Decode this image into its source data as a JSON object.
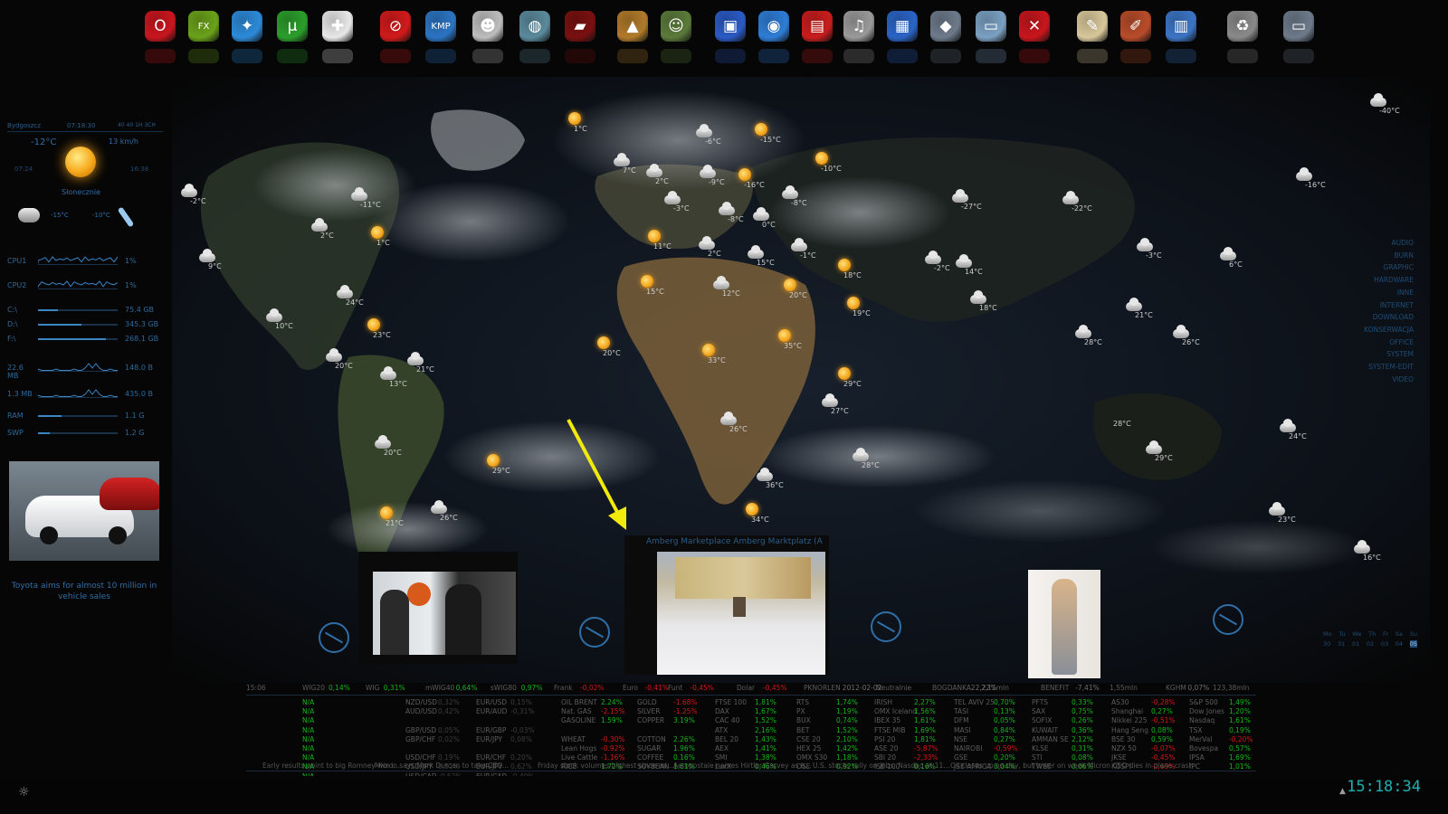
{
  "dock": {
    "icons": [
      {
        "name": "opera-icon",
        "glyph": "O",
        "color": "#c8161d"
      },
      {
        "name": "fx-icon",
        "glyph": "FX",
        "color": "#6aa11a"
      },
      {
        "name": "messenger-icon",
        "glyph": "✦",
        "color": "#2c8ad8"
      },
      {
        "name": "utorrent-icon",
        "glyph": "μ",
        "color": "#2b9e2b"
      },
      {
        "name": "gamepad-icon",
        "glyph": "✚",
        "color": "#e8e8e8"
      },
      {
        "name": "no-entry-icon",
        "glyph": "⊘",
        "color": "#d11a1a"
      },
      {
        "name": "kmp-player-icon",
        "glyph": "KMP",
        "color": "#2b74c2"
      },
      {
        "name": "alien-icon",
        "glyph": "☻",
        "color": "#bdbdbd"
      },
      {
        "name": "globe-icon",
        "glyph": "◍",
        "color": "#5a8a9c"
      },
      {
        "name": "race-car-icon",
        "glyph": "▰",
        "color": "#7a1010"
      },
      {
        "name": "tank-icon",
        "glyph": "▲",
        "color": "#b07a2a"
      },
      {
        "name": "soldier-icon",
        "glyph": "☺",
        "color": "#5b7a3a"
      },
      {
        "name": "monitor-icon",
        "glyph": "▣",
        "color": "#2a5ac4"
      },
      {
        "name": "disc-icon",
        "glyph": "◉",
        "color": "#2e7dd6"
      },
      {
        "name": "toolbox-icon",
        "glyph": "▤",
        "color": "#c81d1d"
      },
      {
        "name": "headphones-icon",
        "glyph": "♫",
        "color": "#9a9a9a"
      },
      {
        "name": "clapperboard-icon",
        "glyph": "▦",
        "color": "#2a64c6"
      },
      {
        "name": "scanner-icon",
        "glyph": "◆",
        "color": "#6d7a8a"
      },
      {
        "name": "folder-icon",
        "glyph": "▭",
        "color": "#7aa0c2"
      },
      {
        "name": "close-app-icon",
        "glyph": "✕",
        "color": "#c8161d"
      },
      {
        "name": "notepad-icon",
        "glyph": "✎",
        "color": "#d8c79a"
      },
      {
        "name": "paint-icon",
        "glyph": "✐",
        "color": "#b84c2a"
      },
      {
        "name": "calculator-icon",
        "glyph": "▥",
        "color": "#3c74c4"
      },
      {
        "name": "recycle-bin-icon",
        "glyph": "♻",
        "color": "#8a8a8a"
      },
      {
        "name": "screen-icon",
        "glyph": "▭",
        "color": "#6d7a8a"
      }
    ]
  },
  "weather": {
    "city": "Bydgoszcz",
    "time": "07:18:30",
    "extra": "40 40 1H 3CH",
    "temp": "-12°C",
    "wind": "13 km/h",
    "sunrise": "07:24",
    "sunset": "16:38",
    "condition": "Słonecznie",
    "forecast_low": "-15°C",
    "forecast_high": "-10°C"
  },
  "meters": [
    {
      "label": "CPU1",
      "value": "1%",
      "type": "graph"
    },
    {
      "label": "CPU2",
      "value": "1%",
      "type": "graph"
    },
    {
      "label": "C:\\",
      "value": "75.4 GB",
      "type": "bar",
      "fill": 0.25
    },
    {
      "label": "D:\\",
      "value": "345.3 GB",
      "type": "bar",
      "fill": 0.55
    },
    {
      "label": "F:\\",
      "value": "268.1 GB",
      "type": "bar",
      "fill": 0.85
    },
    {
      "label": "22.6 MB",
      "value": "148.0 B",
      "type": "graph"
    },
    {
      "label": "1.3 MB",
      "value": "435.0 B",
      "type": "graph"
    },
    {
      "label": "RAM",
      "value": "1.1 G",
      "type": "bar",
      "fill": 0.3
    },
    {
      "label": "SWP",
      "value": "1.2 G",
      "type": "bar",
      "fill": 0.15
    }
  ],
  "news_widget": {
    "headline": "Toyota aims for almost 10 million in vehicle sales"
  },
  "right_menu": [
    "AUDIO",
    "BURN",
    "GRAPHIC",
    "HARDWARE",
    "INNE",
    "INTERNET",
    "DOWNLOAD",
    "KONSERWACJA",
    "OFFICE",
    "SYSTEM",
    "SYSTEM-EDIT",
    "VIDEO"
  ],
  "map_markers": [
    {
      "t": "1°C",
      "k": "sun"
    },
    {
      "t": "-6°C",
      "k": "cloud"
    },
    {
      "t": "-15°C",
      "k": "sun"
    },
    {
      "t": "-10°C",
      "k": "sun"
    },
    {
      "t": "7°C",
      "k": "cloud"
    },
    {
      "t": "2°C",
      "k": "cloud"
    },
    {
      "t": "-9°C",
      "k": "cloud"
    },
    {
      "t": "-16°C",
      "k": "sun"
    },
    {
      "t": "-8°C",
      "k": "cloud"
    },
    {
      "t": "-11°C",
      "k": "cloud"
    },
    {
      "t": "-3°C",
      "k": "cloud"
    },
    {
      "t": "-8°C",
      "k": "cloud"
    },
    {
      "t": "0°C",
      "k": "cloud"
    },
    {
      "t": "-2°C",
      "k": "cloud"
    },
    {
      "t": "2°C",
      "k": "cloud"
    },
    {
      "t": "1°C",
      "k": "sun"
    },
    {
      "t": "11°C",
      "k": "sun"
    },
    {
      "t": "2°C",
      "k": "cloud"
    },
    {
      "t": "15°C",
      "k": "cloud"
    },
    {
      "t": "-1°C",
      "k": "cloud"
    },
    {
      "t": "9°C",
      "k": "cloud"
    },
    {
      "t": "18°C",
      "k": "sun"
    },
    {
      "t": "15°C",
      "k": "sun"
    },
    {
      "t": "12°C",
      "k": "cloud"
    },
    {
      "t": "20°C",
      "k": "sun"
    },
    {
      "t": "19°C",
      "k": "sun"
    },
    {
      "t": "24°C",
      "k": "cloud"
    },
    {
      "t": "10°C",
      "k": "cloud"
    },
    {
      "t": "23°C",
      "k": "sun"
    },
    {
      "t": "20°C",
      "k": "sun"
    },
    {
      "t": "33°C",
      "k": "sun"
    },
    {
      "t": "35°C",
      "k": "sun"
    },
    {
      "t": "20°C",
      "k": "cloud"
    },
    {
      "t": "21°C",
      "k": "cloud"
    },
    {
      "t": "13°C",
      "k": "cloud"
    },
    {
      "t": "29°C",
      "k": "sun"
    },
    {
      "t": "27°C",
      "k": "cloud"
    },
    {
      "t": "26°C",
      "k": "cloud"
    },
    {
      "t": "20°C",
      "k": "cloud"
    },
    {
      "t": "29°C",
      "k": "sun"
    },
    {
      "t": "28°C",
      "k": "cloud"
    },
    {
      "t": "36°C",
      "k": "cloud"
    },
    {
      "t": "34°C",
      "k": "sun"
    },
    {
      "t": "21°C",
      "k": "sun"
    },
    {
      "t": "26°C",
      "k": "cloud"
    },
    {
      "t": "-40°C",
      "k": "cloud"
    },
    {
      "t": "-16°C",
      "k": "cloud"
    },
    {
      "t": "-27°C",
      "k": "cloud"
    },
    {
      "t": "-22°C",
      "k": "cloud"
    },
    {
      "t": "-3°C",
      "k": "cloud"
    },
    {
      "t": "6°C",
      "k": "cloud"
    },
    {
      "t": "-2°C",
      "k": "cloud"
    },
    {
      "t": "14°C",
      "k": "cloud"
    },
    {
      "t": "18°C",
      "k": "cloud"
    },
    {
      "t": "21°C",
      "k": "cloud"
    },
    {
      "t": "28°C",
      "k": "cloud"
    },
    {
      "t": "26°C",
      "k": "cloud"
    },
    {
      "t": "28°C",
      "k": "none"
    },
    {
      "t": "24°C",
      "k": "cloud"
    },
    {
      "t": "29°C",
      "k": "cloud"
    },
    {
      "t": "23°C",
      "k": "cloud"
    },
    {
      "t": "16°C",
      "k": "cloud"
    }
  ],
  "webcam": {
    "title": "Amberg Marketplace  Amberg Marktplatz (A"
  },
  "calendar": {
    "days": [
      "Mo",
      "Tu",
      "We",
      "Th",
      "Fr",
      "Sa",
      "Su"
    ],
    "dates": [
      "30",
      "31",
      "01",
      "02",
      "03",
      "04",
      "05"
    ]
  },
  "ticker": {
    "header": [
      {
        "n": "15:06",
        "v": "",
        "c": ""
      },
      {
        "n": "WIG20",
        "v": "0,14%",
        "c": "pos"
      },
      {
        "n": "WIG",
        "v": "0,31%",
        "c": "pos"
      },
      {
        "n": "mWIG40",
        "v": "0,64%",
        "c": "pos"
      },
      {
        "n": "sWIG80",
        "v": "0,97%",
        "c": "pos"
      },
      {
        "n": "Frank",
        "v": "-0,02%",
        "c": "neg"
      },
      {
        "n": "Euro",
        "v": "-0,41%",
        "c": "neg"
      },
      {
        "n": "Funt",
        "v": "-0,45%",
        "c": "neg"
      },
      {
        "n": "Dolar",
        "v": "-0,45%",
        "c": "neg"
      },
      {
        "n": "PKNORLEN",
        "v": "2012-02-02",
        "c": ""
      },
      {
        "n": "Neutralnie",
        "v": "",
        "c": ""
      },
      {
        "n": "BOGDANKA",
        "v": "22,22%",
        "c": ""
      },
      {
        "n": "2,11mln",
        "v": "",
        "c": ""
      },
      {
        "n": "BENEFIT",
        "v": "-7,41%",
        "c": ""
      },
      {
        "n": "1,55mln",
        "v": "",
        "c": ""
      },
      {
        "n": "KGHM",
        "v": "0,07%",
        "c": ""
      },
      {
        "n": "123,38mln",
        "v": "",
        "c": ""
      }
    ],
    "na_col": [
      "N/A",
      "N/A",
      "N/A",
      "N/A",
      "N/A",
      "N/A",
      "N/A",
      "N/A",
      "N/A"
    ],
    "fx_col": [
      [
        "NZD/USD",
        "0,32%",
        "EUR/USD",
        "0,15%"
      ],
      [
        "AUD/USD",
        "0,42%",
        "EUR/AUD",
        "-0,31%"
      ],
      [
        "",
        "",
        "",
        ""
      ],
      [
        "GBP/USD",
        "0,05%",
        "EUR/GBP",
        "-0,03%"
      ],
      [
        "GBP/CHF",
        "0,02%",
        "EUR/JPY",
        "0,08%"
      ],
      [
        "",
        "",
        "",
        ""
      ],
      [
        "USD/CHF",
        "0,19%",
        "EUR/CHF",
        "0,20%"
      ],
      [
        "USD/JPY",
        "0,51%",
        "EUR/JPY",
        "0,62%"
      ],
      [
        "USD/CAD",
        "-0,52%",
        "EUR/CAD",
        "-0,40%"
      ]
    ],
    "commod_col": [
      [
        "OIL BRENT",
        "2.24%",
        "GOLD",
        "-1.68%"
      ],
      [
        "Nat. GAS",
        "-2.15%",
        "SILVER",
        "-1.25%"
      ],
      [
        "GASOLINE",
        "1.59%",
        "COPPER",
        "3.19%"
      ],
      [
        "",
        "",
        "",
        ""
      ],
      [
        "WHEAT",
        "-0.30%",
        "COTTON",
        "2.26%"
      ],
      [
        "Lean Hogs",
        "-0.92%",
        "SUGAR",
        "1.96%"
      ],
      [
        "Live Cattle",
        "-1.16%",
        "COFFEE",
        "0.16%"
      ],
      [
        "RICE",
        "1.72%",
        "SOYBEAN",
        "1.61%"
      ]
    ],
    "index_col": [
      [
        "FTSE 100",
        "1,81%",
        "RTS",
        "1,74%",
        "IRISH",
        "2,27%",
        "TEL AVIV 25",
        "0,70%",
        "PFTS",
        "0,33%",
        "AS30",
        "-0,28%",
        "S&P 500",
        "1,49%"
      ],
      [
        "DAX",
        "1,67%",
        "PX",
        "1,19%",
        "OMX Iceland",
        "1,56%",
        "TASI",
        "0,13%",
        "SAX",
        "0,75%",
        "Shanghai",
        "0,27%",
        "Dow Jones",
        "1,20%"
      ],
      [
        "CAC 40",
        "1,52%",
        "BUX",
        "0,74%",
        "IBEX 35",
        "1,61%",
        "DFM",
        "0,05%",
        "SOFIX",
        "0,26%",
        "Nikkei 225",
        "-0,51%",
        "Nasdaq",
        "1,61%"
      ],
      [
        "ATX",
        "2,16%",
        "BET",
        "1,52%",
        "FTSE MIB",
        "1,69%",
        "MASI",
        "0,84%",
        "KUWAIT",
        "0,36%",
        "Hang Seng",
        "0,08%",
        "TSX",
        "0,19%"
      ],
      [
        "BEL 20",
        "1,43%",
        "CSE 20",
        "2,10%",
        "PSI 20",
        "1,81%",
        "NSE",
        "0,27%",
        "AMMAN SE",
        "2,12%",
        "BSE 30",
        "0,59%",
        "MerVal",
        "-0,20%"
      ],
      [
        "AEX",
        "1,41%",
        "HEX 25",
        "1,42%",
        "ASE 20",
        "-5,87%",
        "NAIROBI",
        "-0,59%",
        "KLSE",
        "0,31%",
        "NZX 50",
        "-0,07%",
        "Bovespa",
        "0,57%"
      ],
      [
        "SMI",
        "1,38%",
        "OMX S30",
        "1,18%",
        "SBI 20",
        "-2,33%",
        "GSE",
        "0,20%",
        "STI",
        "0,08%",
        "JKSE",
        "-0,45%",
        "IPSA",
        "1,69%"
      ],
      [
        "LuxX",
        "0,46%",
        "OSE",
        "0,92%",
        "ISE 100",
        "0,16%",
        "JSE AFRICA",
        "0,04%",
        "TWSE",
        "0,06%",
        "KOSPI",
        "-0,69%",
        "IPC",
        "1,01%"
      ]
    ],
    "news": [
      "Early results point to big Romney win i...",
      "Micron says Mark Durcan to take CEO...",
      "Friday stock volumes highest since mi...",
      "Aeropostale names Hirtler-Garvey as b...",
      "U.S. stocks rally on jobs; Nasdaq at 11...",
      "Oil closes up on day, but lower on week",
      "Micron CEO dies in plane crash"
    ]
  },
  "taskbar": {
    "clock": "15:18:34",
    "start_glyph": "☼",
    "tray_glyph": "▲"
  },
  "annotation": {
    "color": "#f2ea0a"
  }
}
